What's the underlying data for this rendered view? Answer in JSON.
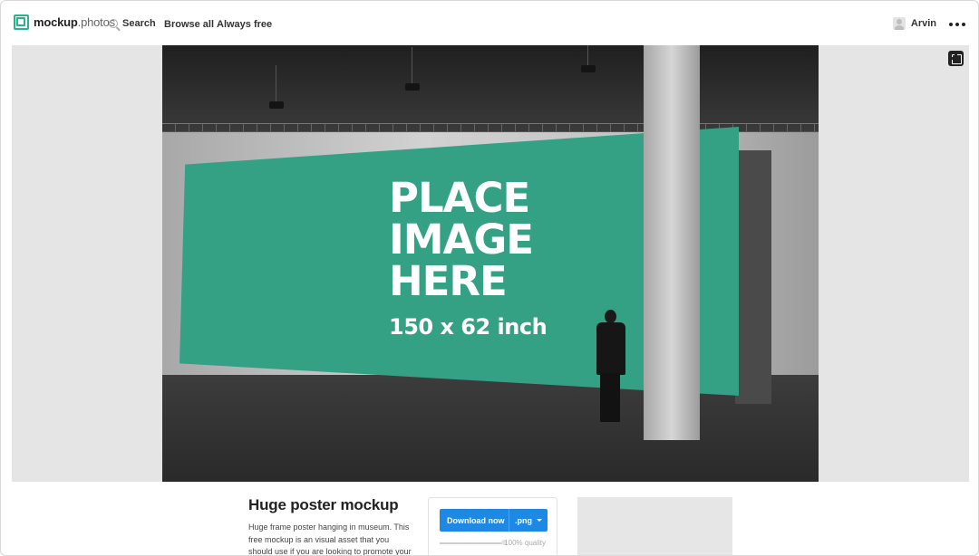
{
  "header": {
    "brand_bold": "mockup",
    "brand_light": "photos",
    "search_label": "Search",
    "nav": [
      {
        "label": "Browse all"
      },
      {
        "label": "Always free"
      }
    ],
    "user_name": "Arvin"
  },
  "preview": {
    "poster_text": "PLACE\nIMAGE\nHERE",
    "poster_size": "150 x 62 inch",
    "poster_color": "#34a184"
  },
  "details": {
    "title": "Huge poster mockup",
    "description": "Huge frame poster hanging in museum. This free mockup is an visual asset that you should use if you are looking to promote your latest"
  },
  "download": {
    "button_label": "Download now",
    "format": ".png",
    "quality_label": "100% quality",
    "quality": 1.0,
    "accent": "#1e88e5"
  },
  "icons": {
    "logo": "logo-icon",
    "search": "search-icon",
    "avatar": "avatar-icon",
    "more": "more-icon",
    "fullscreen": "fullscreen-icon",
    "caret": "caret-down-icon"
  }
}
